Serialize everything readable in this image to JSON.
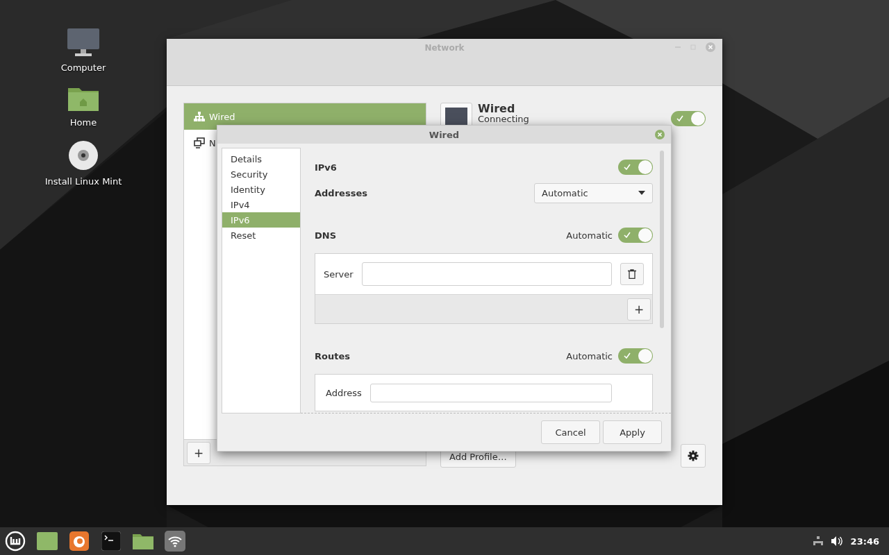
{
  "desktop": {
    "icons": [
      {
        "label": "Computer",
        "kind": "computer"
      },
      {
        "label": "Home",
        "kind": "folder"
      },
      {
        "label": "Install Linux Mint",
        "kind": "disc"
      }
    ]
  },
  "network_window": {
    "title": "Network",
    "connections": [
      {
        "label": "Wired",
        "kind": "wired",
        "selected": true
      },
      {
        "label": "N",
        "kind": "network",
        "selected": false
      }
    ],
    "add_button": "+",
    "device": {
      "name": "Wired",
      "status": "Connecting",
      "on": true
    },
    "add_profile_button": "Add Profile…"
  },
  "dialog": {
    "title": "Wired",
    "pages": [
      {
        "label": "Details",
        "selected": false
      },
      {
        "label": "Security",
        "selected": false
      },
      {
        "label": "Identity",
        "selected": false
      },
      {
        "label": "IPv4",
        "selected": false
      },
      {
        "label": "IPv6",
        "selected": true
      },
      {
        "label": "Reset",
        "selected": false
      }
    ],
    "ipv6": {
      "label": "IPv6",
      "on": true
    },
    "addresses": {
      "label": "Addresses",
      "value": "Automatic"
    },
    "dns": {
      "label": "DNS",
      "auto_label": "Automatic",
      "on": true,
      "server_label": "Server",
      "add_button": "+"
    },
    "routes": {
      "label": "Routes",
      "auto_label": "Automatic",
      "on": true,
      "address_label": "Address"
    },
    "buttons": [
      "Cancel",
      "Apply"
    ]
  },
  "taskbar": {
    "clock": "23:46"
  }
}
